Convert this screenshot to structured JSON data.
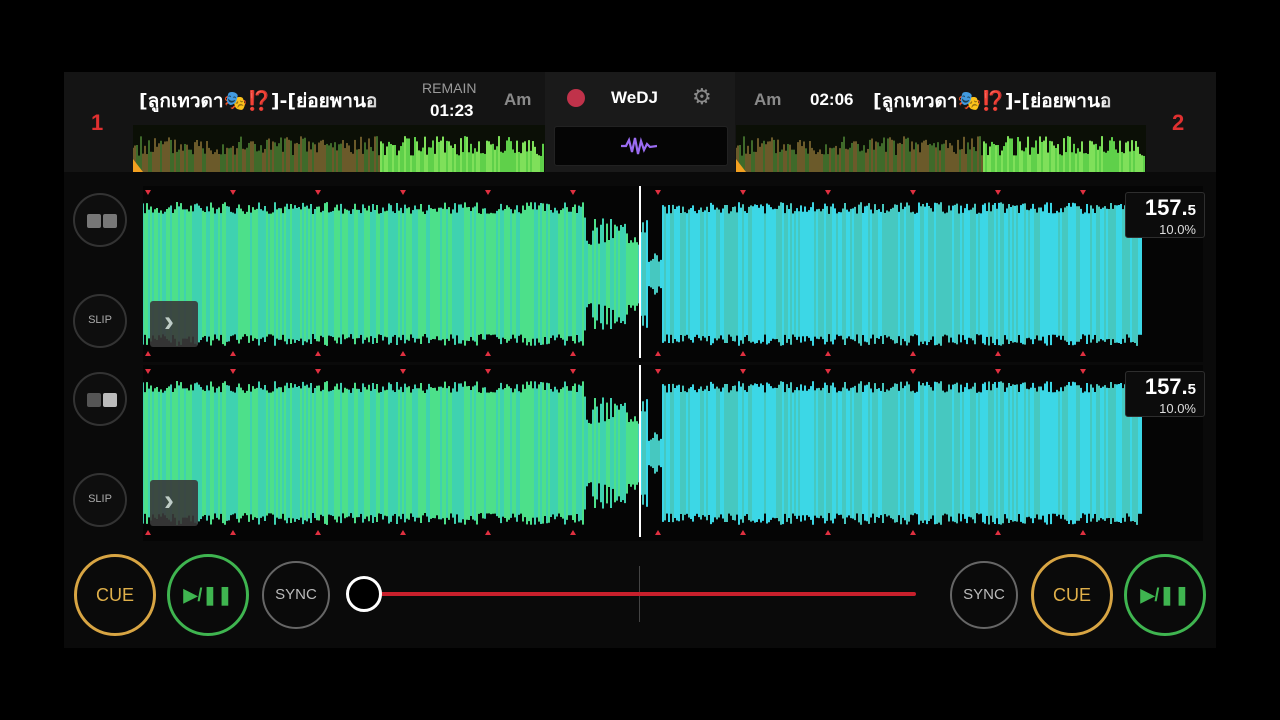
{
  "deck1": {
    "number": "1",
    "title": "[ลูกเทวดา🎭⁉️]-[ย่อยพานอ",
    "remain_label": "REMAIN",
    "time": "01:23",
    "key": "Am"
  },
  "deck2": {
    "number": "2",
    "title": "[ลูกเทวดา🎭⁉️]-[ย่อยพานอ",
    "time": "02:06",
    "key": "Am"
  },
  "center": {
    "brand": "WeDJ",
    "gear_icon": "⚙"
  },
  "lanes": [
    {
      "slip_label": "SLIP",
      "bpm_main": "157.",
      "bpm_decimal": "5",
      "pitch": "10.0%"
    },
    {
      "slip_label": "SLIP",
      "bpm_main": "157.",
      "bpm_decimal": "5",
      "pitch": "10.0%"
    }
  ],
  "controls": {
    "cue_left": "CUE",
    "play_left": "▶/❚❚",
    "sync_left": "SYNC",
    "sync_right": "SYNC",
    "cue_right": "CUE",
    "play_right": "▶/❚❚"
  },
  "colors": {
    "deck_number": "#e03030",
    "cue": "#d8a543",
    "play": "#3fb550",
    "crossfader": "#c8202c",
    "wave_green": "#4de08a",
    "wave_cyan": "#3cd7e6"
  }
}
